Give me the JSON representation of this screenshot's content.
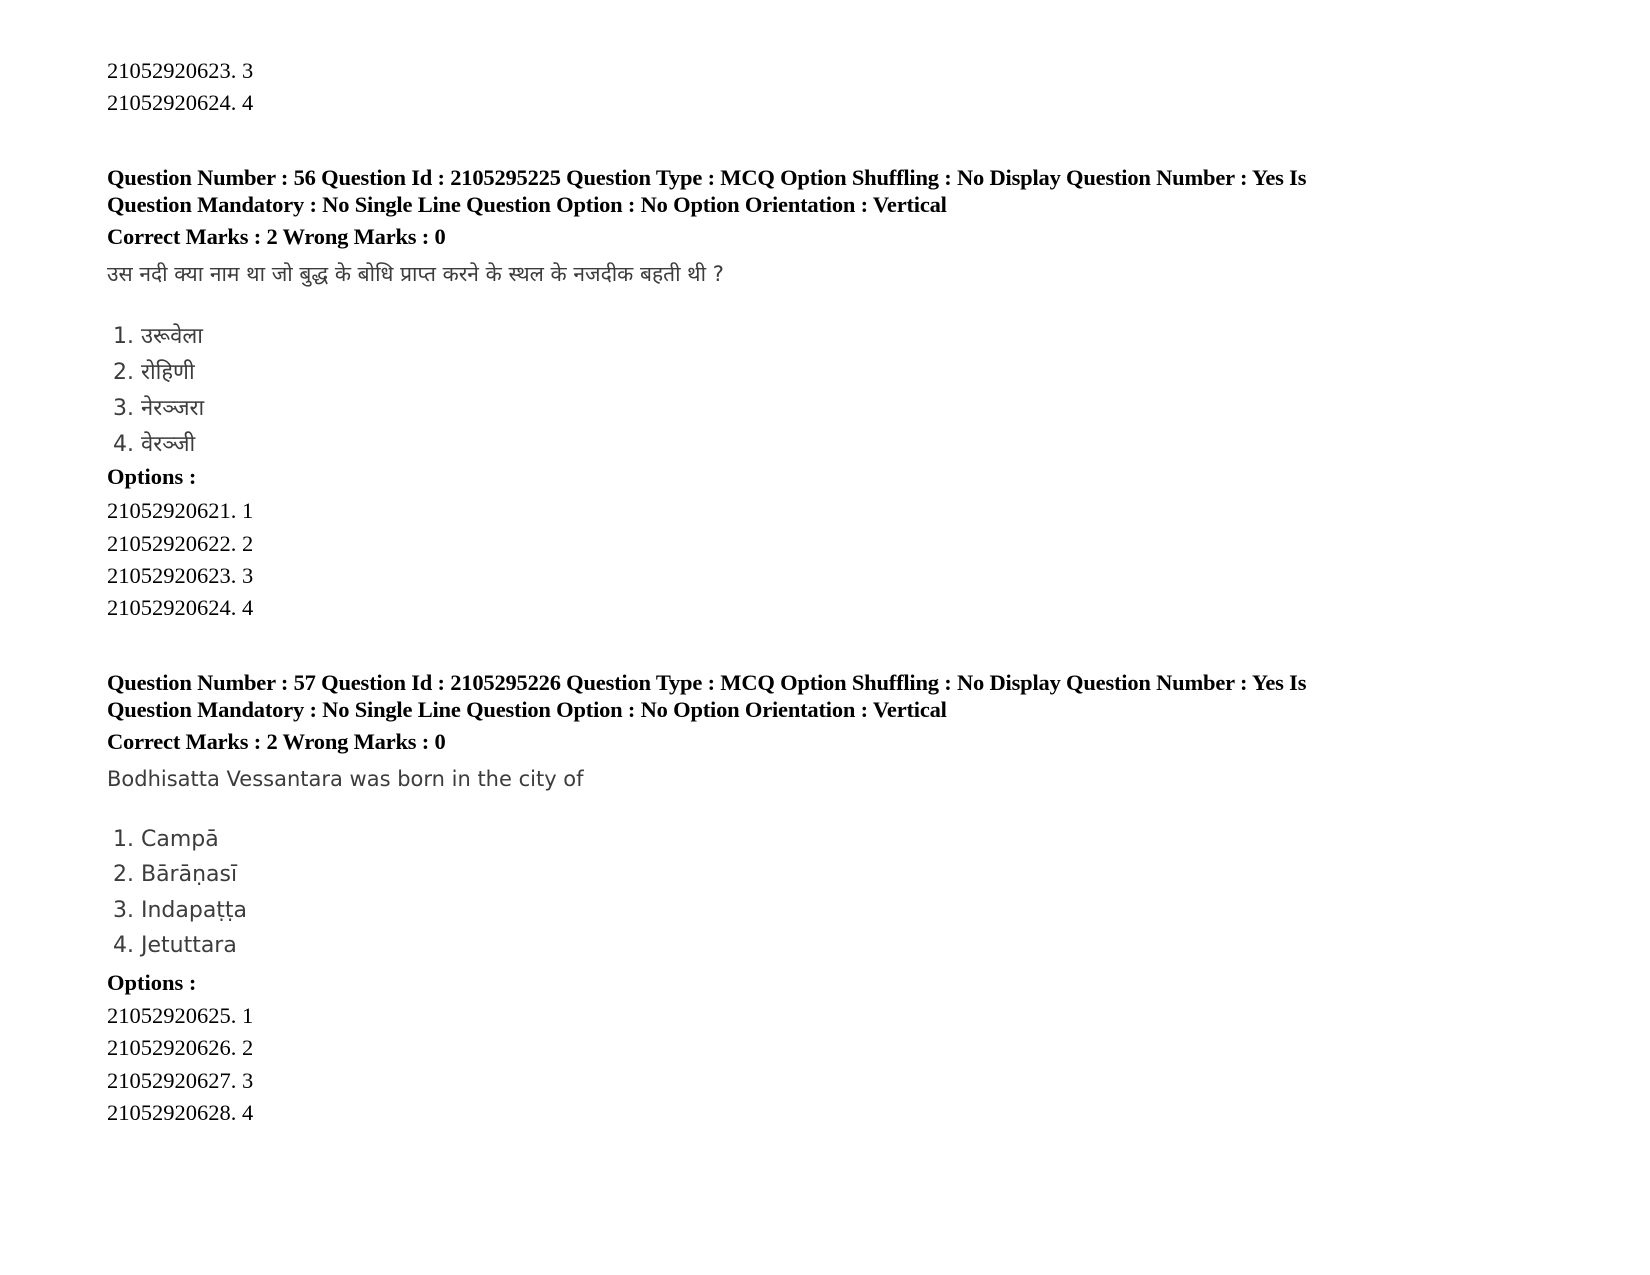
{
  "carryover_options": [
    {
      "id": "21052920623",
      "label": "3"
    },
    {
      "id": "21052920624",
      "label": "4"
    }
  ],
  "questions": [
    {
      "meta_line1": "Question Number : 56 Question Id : 2105295225 Question Type : MCQ Option Shuffling : No Display Question Number : Yes Is",
      "meta_line2": "Question Mandatory : No Single Line Question Option : No Option Orientation : Vertical",
      "marks": "Correct Marks : 2 Wrong Marks : 0",
      "question_text": "उस नदी  क्या नाम था जो बुद्ध के बोधि प्राप्त करने के स्थल के नजदीक बहती थी ?",
      "choices": [
        "1. उरूवेला",
        "2. रोहिणी",
        "3. नेरञ्जरा",
        "4. वेरञ्जी"
      ],
      "options_heading": "Options :",
      "options": [
        {
          "id": "21052920621",
          "label": "1"
        },
        {
          "id": "21052920622",
          "label": "2"
        },
        {
          "id": "21052920623",
          "label": "3"
        },
        {
          "id": "21052920624",
          "label": "4"
        }
      ]
    },
    {
      "meta_line1": "Question Number : 57 Question Id : 2105295226 Question Type : MCQ Option Shuffling : No Display Question Number : Yes Is",
      "meta_line2": "Question Mandatory : No Single Line Question Option : No Option Orientation : Vertical",
      "marks": "Correct Marks : 2 Wrong Marks : 0",
      "question_text": "Bodhisatta Vessantara was born in the city of",
      "choices": [
        "1. Campā",
        "2. Bārāṇasī",
        "3. Indapaṭṭa",
        "4. Jetuttara"
      ],
      "options_heading": "Options :",
      "options": [
        {
          "id": "21052920625",
          "label": "1"
        },
        {
          "id": "21052920626",
          "label": "2"
        },
        {
          "id": "21052920627",
          "label": "3"
        },
        {
          "id": "21052920628",
          "label": "4"
        }
      ]
    }
  ]
}
